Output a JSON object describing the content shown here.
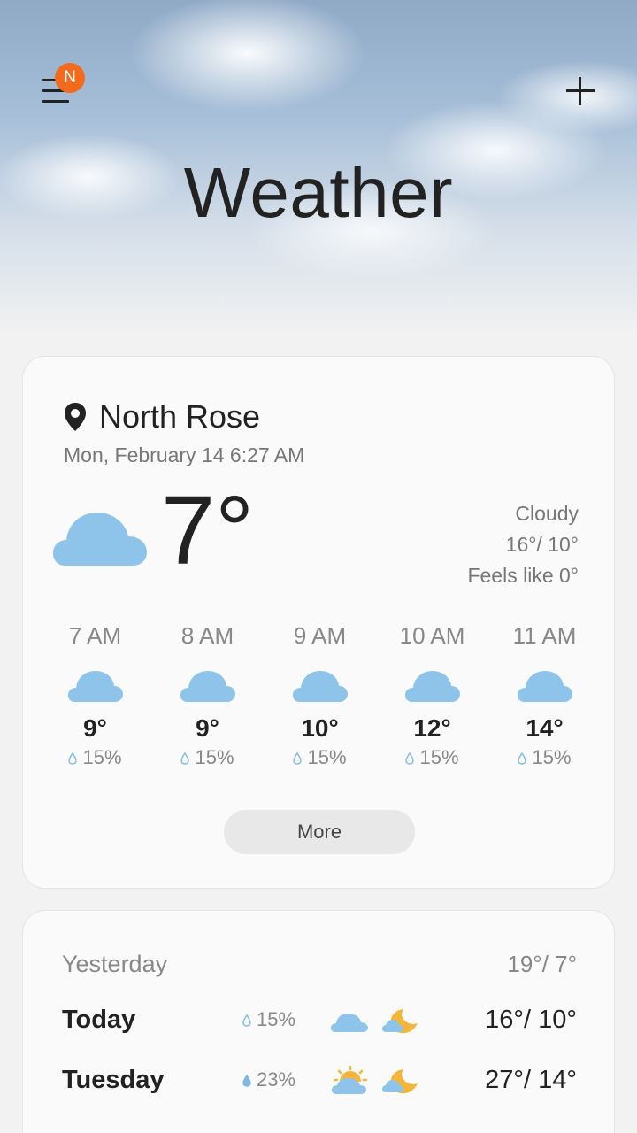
{
  "header": {
    "title": "Weather",
    "notification_badge": "N",
    "accent_color": "#f26a1b"
  },
  "current": {
    "location": "North Rose",
    "datetime": "Mon, February 14 6:27 AM",
    "temperature": "7°",
    "condition": "Cloudy",
    "high_low": "16°/ 10°",
    "feels_like": "Feels like 0°",
    "icon": "cloud-icon"
  },
  "hourly": [
    {
      "time": "7 AM",
      "temp": "9°",
      "rain": "15%",
      "icon": "cloud-icon"
    },
    {
      "time": "8 AM",
      "temp": "9°",
      "rain": "15%",
      "icon": "cloud-icon"
    },
    {
      "time": "9 AM",
      "temp": "10°",
      "rain": "15%",
      "icon": "cloud-icon"
    },
    {
      "time": "10 AM",
      "temp": "12°",
      "rain": "15%",
      "icon": "cloud-icon"
    },
    {
      "time": "11 AM",
      "temp": "14°",
      "rain": "15%",
      "icon": "cloud-icon"
    }
  ],
  "more_label": "More",
  "daily": [
    {
      "day": "Yesterday",
      "high_low": "19°/ 7°"
    },
    {
      "day": "Today",
      "rain": "15%",
      "high_low": "16°/ 10°",
      "day_icon": "cloud-icon",
      "night_icon": "cloudy-moon-icon"
    },
    {
      "day": "Tuesday",
      "rain": "23%",
      "high_low": "27°/ 14°",
      "day_icon": "partly-sunny-icon",
      "night_icon": "cloudy-moon-icon"
    }
  ],
  "colors": {
    "cloud": "#8ec4ea",
    "moon": "#f4b63a",
    "sun": "#f4b63a",
    "drop": "#7fb8e2"
  }
}
